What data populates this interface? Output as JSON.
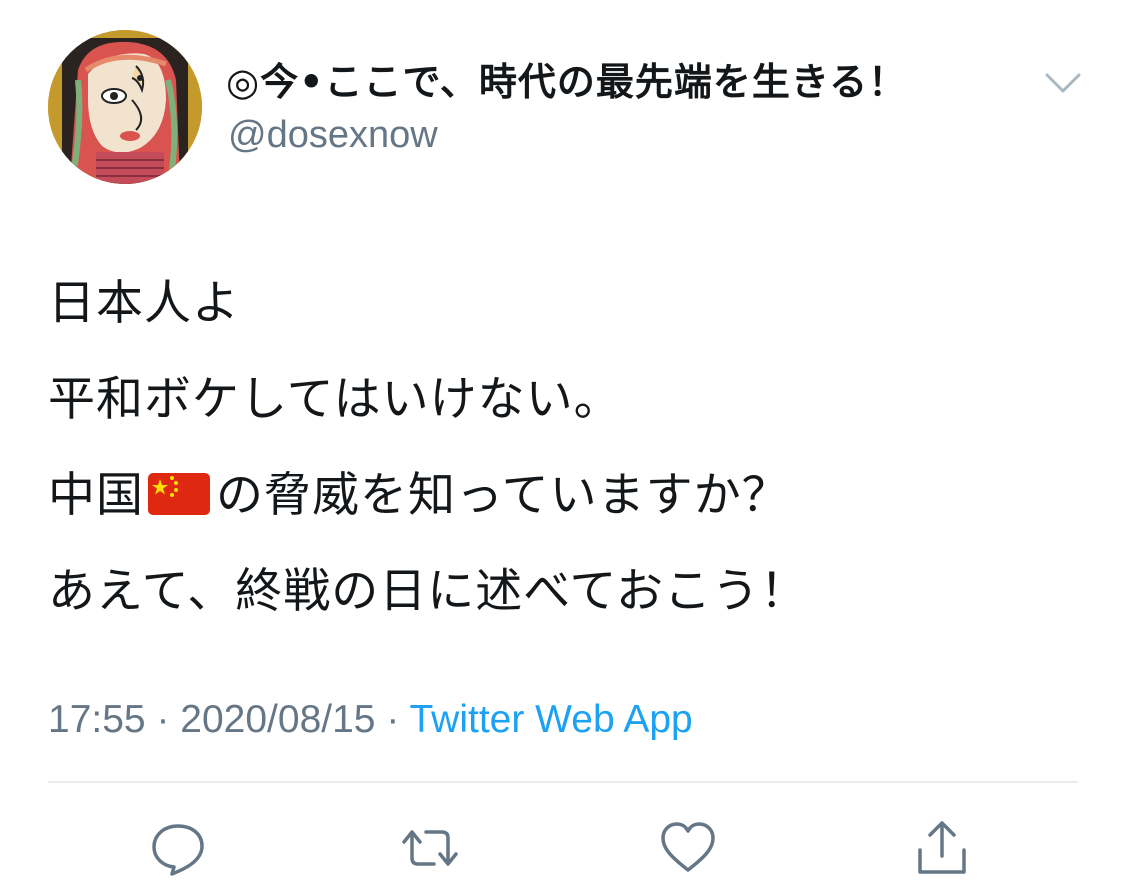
{
  "tweet": {
    "author": {
      "display_name": "◎今•ここで、時代の最先端を生きる！",
      "handle": "@dosexnow"
    },
    "text_lines": [
      {
        "parts": [
          "日本人よ"
        ]
      },
      {
        "parts": [
          "平和ボケしてはいけない。"
        ]
      },
      {
        "before_flag": "中国",
        "flag": "china-flag-emoji",
        "after_flag": "の脅威を知っていますか？"
      },
      {
        "parts": [
          "あえて、終戦の日に述べておこう！"
        ]
      }
    ],
    "meta": {
      "time": "17:55",
      "separator": "·",
      "date": "2020/08/15",
      "source": "Twitter Web App"
    }
  },
  "actions": [
    {
      "icon": "reply-icon"
    },
    {
      "icon": "retweet-icon"
    },
    {
      "icon": "like-icon"
    },
    {
      "icon": "share-icon"
    }
  ],
  "colors": {
    "text": "#14171a",
    "secondary": "#657786",
    "link": "#1da1f2",
    "divider": "#e6ecf0"
  }
}
